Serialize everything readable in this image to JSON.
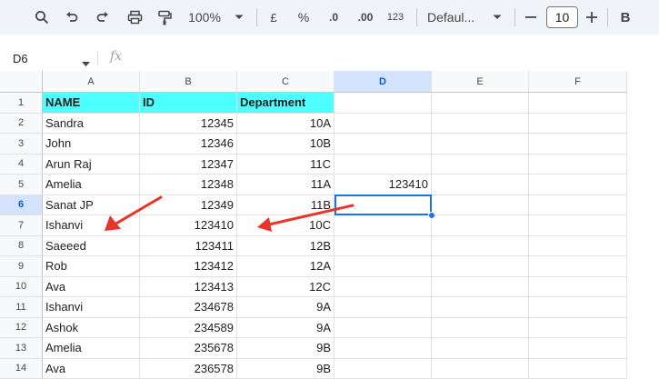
{
  "toolbar": {
    "zoom": "100%",
    "currency_label": "£",
    "percent_label": "%",
    "decrease_decimal_label": ".0",
    "increase_decimal_label": ".00",
    "number_format_label": "123",
    "font_name": "Defaul...",
    "font_size": "10",
    "bold_label": "B"
  },
  "formula_bar": {
    "cell_reference": "D6",
    "fx_label": "fx"
  },
  "columns": [
    "A",
    "B",
    "C",
    "D",
    "E",
    "F"
  ],
  "selected_column": "D",
  "selected_row": "6",
  "rows": [
    {
      "n": "1",
      "a": "NAME",
      "b": "ID",
      "c": "Department",
      "d": ""
    },
    {
      "n": "2",
      "a": "Sandra",
      "b": "12345",
      "c": "10A",
      "d": ""
    },
    {
      "n": "3",
      "a": "John",
      "b": "12346",
      "c": "10B",
      "d": ""
    },
    {
      "n": "4",
      "a": "Arun Raj",
      "b": "12347",
      "c": "11C",
      "d": ""
    },
    {
      "n": "5",
      "a": "Amelia",
      "b": "12348",
      "c": "11A",
      "d": "123410"
    },
    {
      "n": "6",
      "a": "Sanat JP",
      "b": "12349",
      "c": "11B",
      "d": ""
    },
    {
      "n": "7",
      "a": "Ishanvi",
      "b": "123410",
      "c": "10C",
      "d": ""
    },
    {
      "n": "8",
      "a": "Saeeed",
      "b": "123411",
      "c": "12B",
      "d": ""
    },
    {
      "n": "9",
      "a": "Rob",
      "b": "123412",
      "c": "12A",
      "d": ""
    },
    {
      "n": "10",
      "a": "Ava",
      "b": "123413",
      "c": "12C",
      "d": ""
    },
    {
      "n": "11",
      "a": "Ishanvi",
      "b": "234678",
      "c": "9A",
      "d": ""
    },
    {
      "n": "12",
      "a": "Ashok",
      "b": "234589",
      "c": "9A",
      "d": ""
    },
    {
      "n": "13",
      "a": "Amelia",
      "b": "235678",
      "c": "9B",
      "d": ""
    },
    {
      "n": "14",
      "a": "Ava",
      "b": "236578",
      "c": "9B",
      "d": ""
    }
  ],
  "colors": {
    "header_fill": "#4effff",
    "selection": "#1a73e8",
    "annotation_arrow": "#e8342a"
  }
}
